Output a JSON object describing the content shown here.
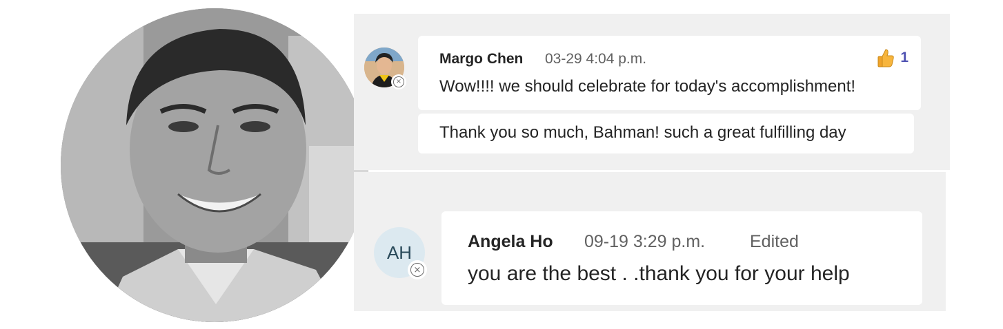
{
  "chat": {
    "messages": [
      {
        "author": "Margo Chen",
        "timestamp": "03-29 4:04 p.m.",
        "text": "Wow!!!! we should celebrate for today's accomplishment!",
        "reaction": {
          "icon": "thumbs-up-icon",
          "count": "1"
        },
        "avatar": "photo"
      },
      {
        "text": "Thank you so much, Bahman! such a great fulfilling day"
      },
      {
        "author": "Angela Ho",
        "timestamp": "09-19 3:29 p.m.",
        "edited_label": "Edited",
        "text": "you are the best . .thank you for your help",
        "avatar_initials": "AH"
      }
    ]
  },
  "colors": {
    "panel_bg": "#f0f0f0",
    "bubble_bg": "#ffffff",
    "reaction_count": "#4f52b2",
    "initials_avatar_bg": "#dce9f0"
  }
}
